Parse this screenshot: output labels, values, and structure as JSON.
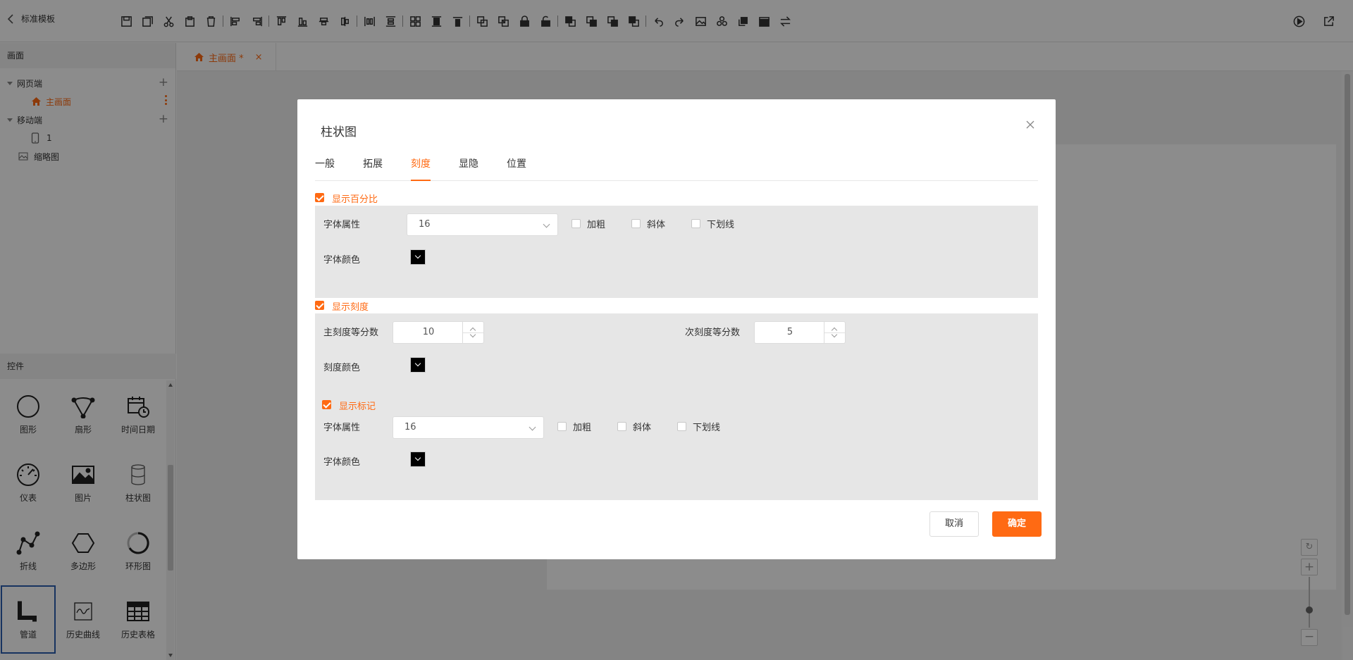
{
  "header": {
    "back_label": "标准模板"
  },
  "left_panel": {
    "screens_title": "画面",
    "tree": {
      "web_label": "网页端",
      "main_screen_label": "主画面",
      "mobile_label": "移动端",
      "mobile_item_label": "1",
      "thumbnail_label": "缩略图"
    },
    "controls_title": "控件",
    "controls": [
      {
        "label": "图形",
        "icon": "circle-icon"
      },
      {
        "label": "扇形",
        "icon": "fan-icon"
      },
      {
        "label": "时间日期",
        "icon": "calendar-clock-icon"
      },
      {
        "label": "仪表",
        "icon": "gauge-icon"
      },
      {
        "label": "图片",
        "icon": "image-icon"
      },
      {
        "label": "柱状图",
        "icon": "cylinder-icon"
      },
      {
        "label": "折线",
        "icon": "polyline-icon"
      },
      {
        "label": "多边形",
        "icon": "hexagon-icon"
      },
      {
        "label": "环形图",
        "icon": "ring-icon"
      },
      {
        "label": "管道",
        "icon": "pipe-icon"
      },
      {
        "label": "历史曲线",
        "icon": "history-curve-icon"
      },
      {
        "label": "历史表格",
        "icon": "table-icon"
      }
    ]
  },
  "editor_tabs": {
    "main_tab_label": "主画面 *"
  },
  "dialog": {
    "title": "柱状图",
    "tabs": [
      "一般",
      "拓展",
      "刻度",
      "显隐",
      "位置"
    ],
    "active_tab": "刻度",
    "percent_section": {
      "label": "显示百分比",
      "checked": true,
      "font_label": "字体属性",
      "font_size": "16",
      "bold_label": "加粗",
      "italic_label": "斜体",
      "underline_label": "下划线",
      "color_label": "字体颜色",
      "color": "#000000"
    },
    "scale_section": {
      "label": "显示刻度",
      "checked": true,
      "major_label": "主刻度等分数",
      "major_value": "10",
      "minor_label": "次刻度等分数",
      "minor_value": "5",
      "scale_color_label": "刻度颜色",
      "scale_color": "#000000",
      "mark_label": "显示标记",
      "mark_checked": true,
      "font_label": "字体属性",
      "font_size": "16",
      "bold_label": "加粗",
      "italic_label": "斜体",
      "underline_label": "下划线",
      "color_label": "字体颜色",
      "color": "#000000"
    },
    "cancel_label": "取消",
    "ok_label": "确定"
  },
  "accent_color": "#ff6a13"
}
